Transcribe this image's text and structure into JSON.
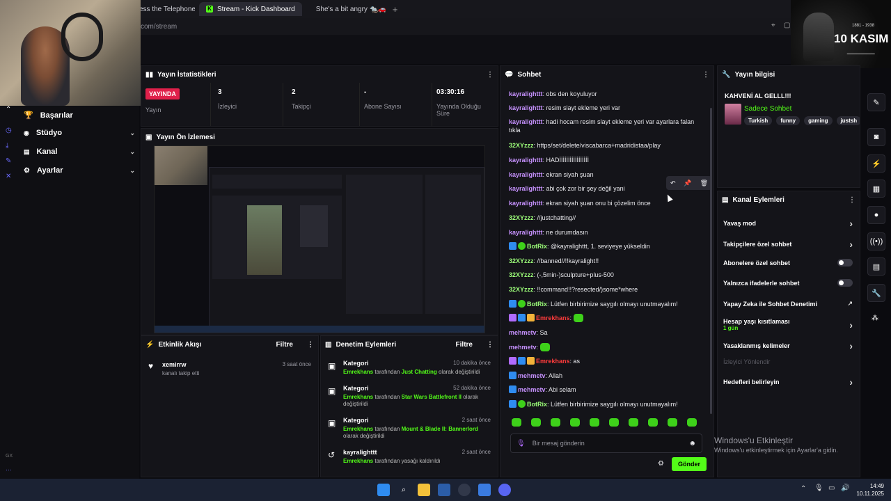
{
  "browser": {
    "tabs": [
      {
        "label": "ess the Telephone",
        "icon": "page-icon"
      },
      {
        "label": "Stream - Kick Dashboard",
        "icon": "kick-icon"
      },
      {
        "label": "She's a bit angry 🐀🚗 |",
        "icon": "youtube-icon"
      }
    ],
    "url": "com/stream"
  },
  "sidebar": {
    "items": [
      {
        "label": "Başarılar",
        "icon": "trophy-icon",
        "chevron": false
      },
      {
        "label": "Stüdyo",
        "icon": "studio-icon",
        "chevron": true
      },
      {
        "label": "Kanal",
        "icon": "channel-icon",
        "chevron": true
      },
      {
        "label": "Ayarlar",
        "icon": "gear-icon",
        "chevron": true
      }
    ],
    "footer": "GX"
  },
  "stats": {
    "title": "Yayın İstatistikleri",
    "live_badge": "YAYINDA",
    "items": [
      {
        "value": "",
        "label": "Yayın"
      },
      {
        "value": "3",
        "label": "İzleyici"
      },
      {
        "value": "2",
        "label": "Takipçi"
      },
      {
        "value": "-",
        "label": "Abone Sayısı"
      },
      {
        "value": "03:30:16",
        "label": "Yayında Olduğu Süre"
      }
    ]
  },
  "preview": {
    "title": "Yayın Ön İzlemesi"
  },
  "overlay": {
    "date_range": "1881 - 1938",
    "title": "10 KASIM"
  },
  "activity": {
    "title": "Etkinlik Akışı",
    "filter": "Filtre",
    "items": [
      {
        "user": "xemirrw",
        "text": "kanalı takip etti",
        "time": "3 saat önce"
      }
    ]
  },
  "moderation": {
    "title": "Denetim Eylemleri",
    "filter": "Filtre",
    "items": [
      {
        "title": "Kategori",
        "time": "10 dakika önce",
        "actor": "Emrekhans",
        "mid": "tarafından",
        "target": "Just Chatting",
        "end": "olarak değiştirildi"
      },
      {
        "title": "Kategori",
        "time": "52 dakika önce",
        "actor": "Emrekhans",
        "mid": "tarafından",
        "target": "Star Wars Battlefront II",
        "end": "olarak değiştirildi"
      },
      {
        "title": "Kategori",
        "time": "2 saat önce",
        "actor": "Emrekhans",
        "mid": "tarafından",
        "target": "Mount & Blade II: Bannerlord",
        "end": "olarak değiştirildi"
      },
      {
        "title": "kayralighttt",
        "time": "2 saat önce",
        "actor": "Emrekhans",
        "mid": "tarafından yasağı kaldırıldı",
        "target": "",
        "end": ""
      }
    ]
  },
  "chat": {
    "title": "Sohbet",
    "messages": [
      {
        "user": "kayralighttt",
        "color": "u-p",
        "text": "obs den koyuluyor",
        "badges": []
      },
      {
        "user": "kayralighttt",
        "color": "u-p",
        "text": "resim slayt ekleme yeri var",
        "badges": []
      },
      {
        "user": "kayralighttt",
        "color": "u-p",
        "text": "hadi hocam resim slayt ekleme yeri var ayarlara falan tıkla",
        "badges": []
      },
      {
        "user": "32XYzzz",
        "color": "u-g",
        "text": "https/set/delete/viscabarca+madridistaa/play",
        "badges": []
      },
      {
        "user": "kayralighttt",
        "color": "u-p",
        "text": "HADİİİİİİİİİİİİİİİİİ",
        "badges": []
      },
      {
        "user": "kayralighttt",
        "color": "u-p",
        "text": "ekran siyah şuan",
        "badges": []
      },
      {
        "user": "kayralighttt",
        "color": "u-p",
        "text": "abi çok zor bir şey değil yani",
        "badges": []
      },
      {
        "user": "kayralighttt",
        "color": "u-p",
        "text": "ekran siyah şuan onu bi çözelim önce",
        "badges": []
      },
      {
        "user": "32XYzzz",
        "color": "u-g",
        "text": "//justchatting//",
        "badges": []
      },
      {
        "user": "kayralighttt",
        "color": "u-p",
        "text": "ne durumdasın",
        "badges": []
      },
      {
        "user": "BotRix",
        "color": "u-g",
        "text": "@kayralighttt, 1. seviyeye yükseldin",
        "badges": [
          "b",
          "g"
        ]
      },
      {
        "user": "32XYzzz",
        "color": "u-g",
        "text": "//banned//!!kayralight!!",
        "badges": []
      },
      {
        "user": "32XYzzz",
        "color": "u-g",
        "text": "(-,5min-)sculpture+plus-500",
        "badges": []
      },
      {
        "user": "32XYzzz",
        "color": "u-g",
        "text": "!!command!!?resected/)some*where",
        "badges": []
      },
      {
        "user": "BotRix",
        "color": "u-g",
        "text": "Lütfen birbirimize saygılı olmayı unutmayalım!",
        "badges": [
          "b",
          "g"
        ]
      },
      {
        "user": "Emrekhans",
        "color": "u-r",
        "text": "",
        "badges": [
          "m",
          "b",
          "y"
        ],
        "emote": true
      },
      {
        "user": "mehmetv",
        "color": "u-p",
        "text": "Sa",
        "badges": []
      },
      {
        "user": "mehmetv",
        "color": "u-p",
        "text": "",
        "badges": [],
        "emote": true
      },
      {
        "user": "Emrekhans",
        "color": "u-r",
        "text": "as",
        "badges": [
          "m",
          "b",
          "y"
        ]
      },
      {
        "user": "mehmetv",
        "color": "u-p",
        "text": "Allah",
        "badges": [
          "b"
        ]
      },
      {
        "user": "mehmetv",
        "color": "u-p",
        "text": "Abi selam",
        "badges": [
          "b"
        ]
      },
      {
        "user": "BotRix",
        "color": "u-g",
        "text": "Lütfen birbirimize saygılı olmayı unutmayalım!",
        "badges": [
          "b",
          "g"
        ]
      }
    ],
    "input_placeholder": "Bir mesaj gönderin",
    "send_label": "Gönder"
  },
  "stream_info": {
    "title": "Yayın bilgisi",
    "stream_title": "KAHVENİ AL GELLL!!!",
    "category": "Sadece Sohbet",
    "tags": [
      "Turkish",
      "funny",
      "gaming",
      "justsh"
    ]
  },
  "channel_actions": {
    "title": "Kanal Eylemleri",
    "items": [
      {
        "label": "Yavaş mod",
        "control": "chevron",
        "sub": ""
      },
      {
        "label": "Takipçilere özel sohbet",
        "control": "chevron",
        "sub": ""
      },
      {
        "label": "Abonelere özel sohbet",
        "control": "toggle",
        "sub": ""
      },
      {
        "label": "Yalnızca ifadelerle sohbet",
        "control": "toggle",
        "sub": ""
      },
      {
        "label": "Yapay Zeka ile Sohbet Denetimi",
        "control": "external",
        "sub": ""
      },
      {
        "label": "Hesap yaşı kısıtlaması",
        "control": "chevron",
        "sub": "1 gün"
      },
      {
        "label": "Yasaklanmış kelimeler",
        "control": "chevron",
        "sub": ""
      },
      {
        "label": "İzleyici Yönlendir",
        "control": "disabled",
        "sub": ""
      },
      {
        "label": "Hedefleri belirleyin",
        "control": "chevron",
        "sub": ""
      }
    ]
  },
  "windows": {
    "activate_title": "Windows'u Etkinleştir",
    "activate_sub": "Windows'u etkinleştirmek için Ayarlar'a gidin.",
    "time": "14:49",
    "date": "10.11.2025"
  },
  "colors": {
    "kick_green": "#53fc18",
    "live_red": "#e0204a",
    "username_purple": "#c792ff"
  }
}
